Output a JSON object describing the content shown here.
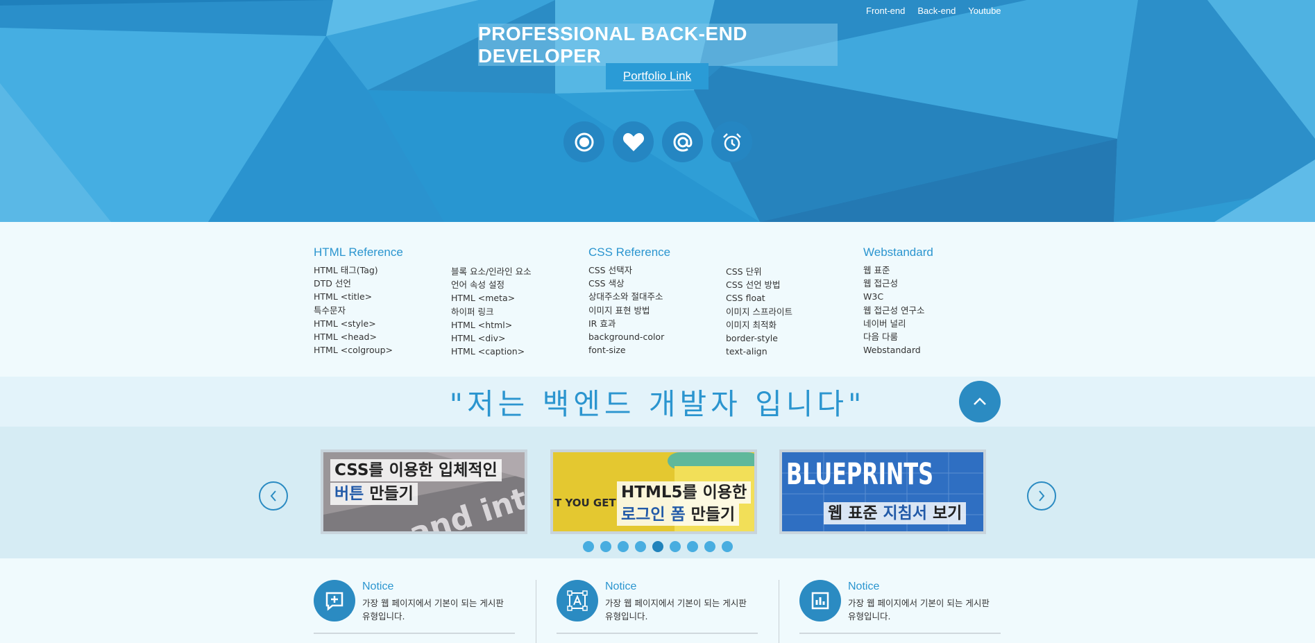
{
  "nav": {
    "items": [
      "Front-end",
      "Back-end",
      "Youtube"
    ]
  },
  "hero": {
    "title": "PROFESSIONAL BACK-END DEVELOPER",
    "button": "Portfolio Link",
    "icons": [
      "record-icon",
      "heart-icon",
      "at-icon",
      "alarm-icon"
    ]
  },
  "refs": {
    "html": {
      "title": "HTML Reference",
      "col1": [
        "HTML 태그(Tag)",
        "DTD 선언",
        "HTML <title>",
        "특수문자",
        "HTML <style>",
        "HTML <head>",
        "HTML <colgroup>"
      ],
      "col2": [
        "블록 요소/인라인 요소",
        "언어 속성 설정",
        "HTML <meta>",
        "하이퍼 링크",
        "HTML <html>",
        "HTML <div>",
        "HTML <caption>"
      ]
    },
    "css": {
      "title": "CSS Reference",
      "col1": [
        "CSS 선택자",
        "CSS 색상",
        "상대주소와 절대주소",
        "이미지 표현 방법",
        "IR 효과",
        "background-color",
        "font-size"
      ],
      "col2": [
        "CSS 단위",
        "CSS 선언 방법",
        "CSS float",
        "이미지 스프라이트",
        "이미지 최적화",
        "border-style",
        "text-align"
      ]
    },
    "web": {
      "title": "Webstandard",
      "col1": [
        "웹 표준",
        "웹 접근성",
        "W3C",
        "웹 접근성 연구소",
        "네이버 널리",
        "다음 다룸",
        "Webstandard"
      ]
    }
  },
  "quote": "\"저는 백엔드 개발자 입니다\"",
  "slides": [
    {
      "line1": "CSS를 이용한 입체적인",
      "line2a": "버튼",
      "line2b": " 만들기",
      "bg_text": "and inte"
    },
    {
      "line1": "HTML5를 이용한",
      "line2a": "로그인 폼",
      "line2b": " 만들기",
      "bg_text": "T YOU GET"
    },
    {
      "line1": "BLUEPRINTS",
      "line2a": "웹 표준 ",
      "line2b": "지침서",
      "line2c": " 보기"
    }
  ],
  "slider": {
    "dot_count": 9,
    "active_dot": 5
  },
  "notices": [
    {
      "title": "Notice",
      "desc": "가장 웹 페이지에서 기본이 되는 게시판 유형입니다.",
      "icon": "plus-square-icon"
    },
    {
      "title": "Notice",
      "desc": "가장 웹 페이지에서 기본이 되는 게시판 유형입니다.",
      "icon": "text-box-icon"
    },
    {
      "title": "Notice",
      "desc": "가장 웹 페이지에서 기본이 되는 게시판 유형입니다.",
      "icon": "bar-chart-icon"
    }
  ],
  "colors": {
    "primary": "#2b95cf",
    "dark": "#2b8bc2",
    "hero_bg": "#2b95cf",
    "page_bg": "#f0fafd"
  }
}
